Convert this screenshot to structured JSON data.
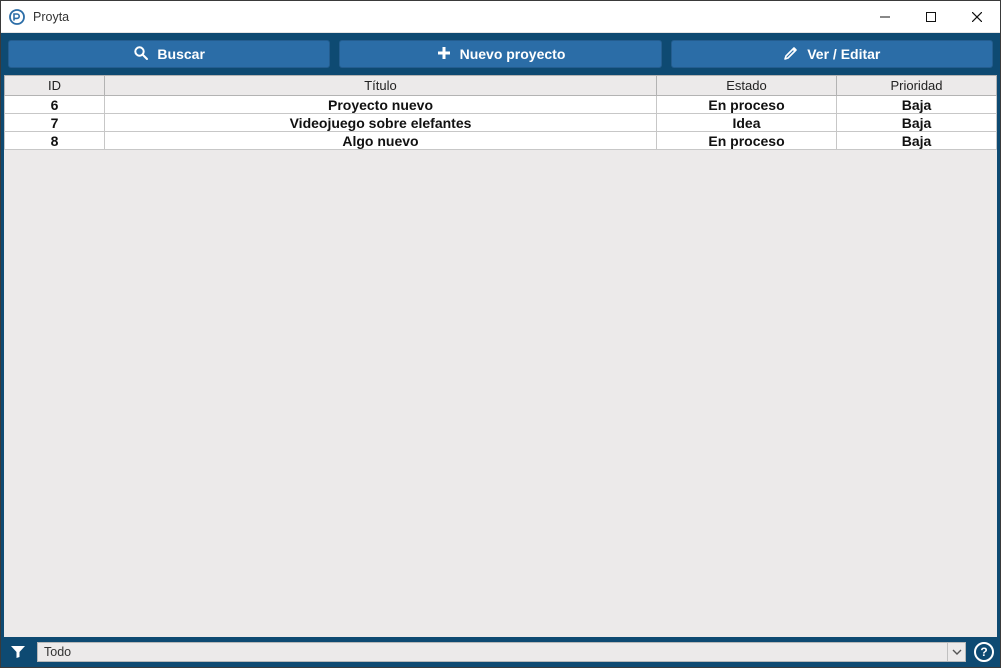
{
  "window": {
    "title": "Proyta"
  },
  "toolbar": {
    "search_label": "Buscar",
    "new_project_label": "Nuevo proyecto",
    "view_edit_label": "Ver / Editar"
  },
  "table": {
    "headers": {
      "id": "ID",
      "title": "Título",
      "state": "Estado",
      "priority": "Prioridad"
    },
    "rows": [
      {
        "id": "6",
        "title": "Proyecto nuevo",
        "state": "En proceso",
        "priority": "Baja"
      },
      {
        "id": "7",
        "title": "Videojuego sobre elefantes",
        "state": "Idea",
        "priority": "Baja"
      },
      {
        "id": "8",
        "title": "Algo nuevo",
        "state": "En proceso",
        "priority": "Baja"
      }
    ]
  },
  "statusbar": {
    "filter_value": "Todo",
    "help_glyph": "?"
  }
}
